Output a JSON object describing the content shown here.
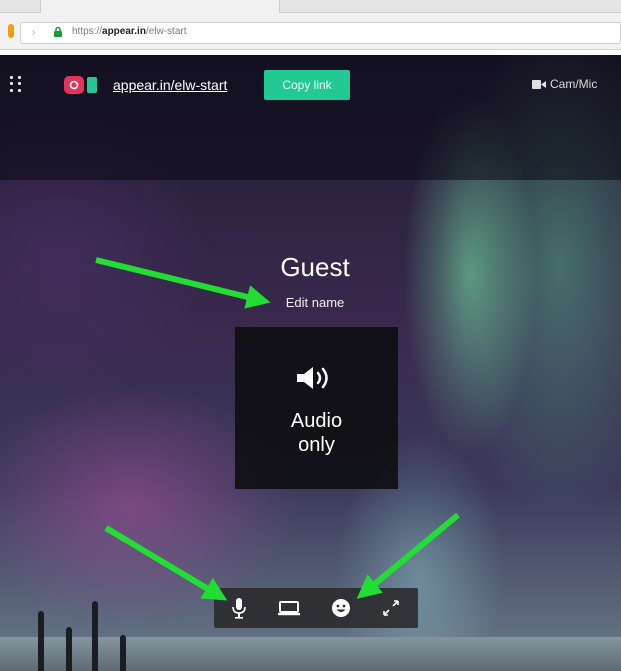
{
  "browser": {
    "url_prefix": "https://",
    "url_domain": "appear.in",
    "url_path": "/elw-start"
  },
  "header": {
    "room_link": "appear.in/elw-start",
    "copy_link_label": "Copy link",
    "cam_mic_label": "Cam/Mic"
  },
  "participant": {
    "name": "Guest",
    "edit_name_label": "Edit name",
    "audio_only_line1": "Audio",
    "audio_only_line2": "only"
  },
  "toolbar": {
    "buttons": [
      "microphone-icon",
      "screen-share-icon",
      "smiley-icon",
      "fullscreen-icon"
    ]
  },
  "colors": {
    "accent": "#22c992",
    "logo": "#e5335a",
    "annotation_arrow": "#22dd33"
  }
}
